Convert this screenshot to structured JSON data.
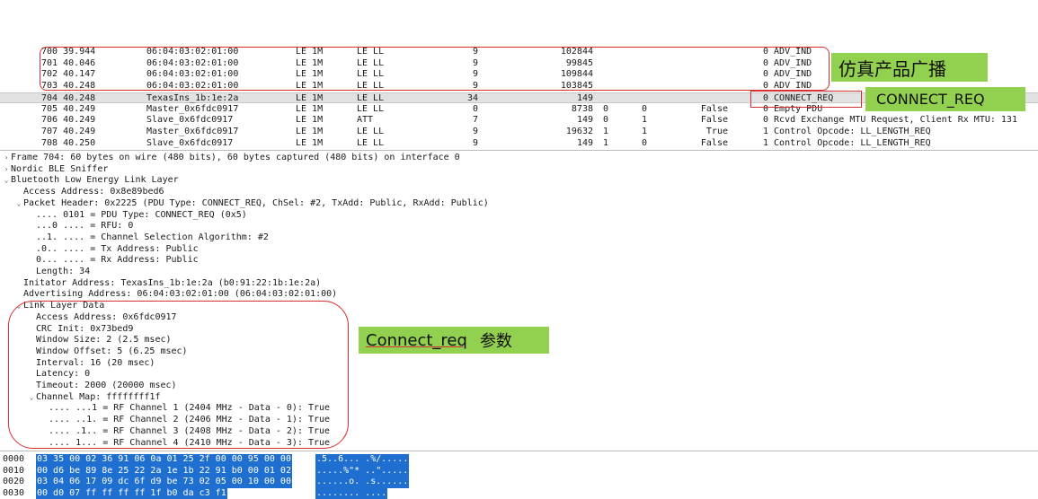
{
  "packets": [
    {
      "no_time": "700 39.944",
      "source": "06:04:03:02:01:00",
      "phy": "LE 1M",
      "protocol": "LE LL",
      "length": "9",
      "delta": "102844",
      "sn": "",
      "nesn": "",
      "more_data": "",
      "info": "0 ADV_IND"
    },
    {
      "no_time": "701 40.046",
      "source": "06:04:03:02:01:00",
      "phy": "LE 1M",
      "protocol": "LE LL",
      "length": "9",
      "delta": "99845",
      "sn": "",
      "nesn": "",
      "more_data": "",
      "info": "0 ADV_IND"
    },
    {
      "no_time": "702 40.147",
      "source": "06:04:03:02:01:00",
      "phy": "LE 1M",
      "protocol": "LE LL",
      "length": "9",
      "delta": "109844",
      "sn": "",
      "nesn": "",
      "more_data": "",
      "info": "0 ADV_IND"
    },
    {
      "no_time": "703 40.248",
      "source": "06:04:03:02:01:00",
      "phy": "LE 1M",
      "protocol": "LE LL",
      "length": "9",
      "delta": "103845",
      "sn": "",
      "nesn": "",
      "more_data": "",
      "info": "0 ADV_IND"
    },
    {
      "no_time": "704 40.248",
      "source": "TexasIns_1b:1e:2a",
      "phy": "LE 1M",
      "protocol": "LE LL",
      "length": "34",
      "delta": "149",
      "sn": "",
      "nesn": "",
      "more_data": "",
      "info": "0 CONNECT_REQ"
    },
    {
      "no_time": "705 40.249",
      "source": "Master_0x6fdc0917",
      "phy": "LE 1M",
      "protocol": "LE LL",
      "length": "0",
      "delta": "8738",
      "sn": "0",
      "nesn": "0",
      "more_data": "False",
      "info": "0 Empty PDU"
    },
    {
      "no_time": "706 40.249",
      "source": "Slave_0x6fdc0917",
      "phy": "LE 1M",
      "protocol": "ATT",
      "length": "7",
      "delta": "149",
      "sn": "0",
      "nesn": "1",
      "more_data": "False",
      "info": "0 Rcvd Exchange MTU Request, Client Rx MTU: 131"
    },
    {
      "no_time": "707 40.249",
      "source": "Master_0x6fdc0917",
      "phy": "LE 1M",
      "protocol": "LE LL",
      "length": "9",
      "delta": "19632",
      "sn": "1",
      "nesn": "1",
      "more_data": "True",
      "info": "1 Control Opcode: LL_LENGTH_REQ"
    },
    {
      "no_time": "708 40.250",
      "source": "Slave_0x6fdc0917",
      "phy": "LE 1M",
      "protocol": "LE LL",
      "length": "9",
      "delta": "149",
      "sn": "1",
      "nesn": "0",
      "more_data": "False",
      "info": "1 Control Opcode: LL_LENGTH_REQ"
    }
  ],
  "selected_packet_index": 4,
  "tree": [
    {
      "indent": 0,
      "arrow": "›",
      "text": "Frame 704: 60 bytes on wire (480 bits), 60 bytes captured (480 bits) on interface 0"
    },
    {
      "indent": 0,
      "arrow": "›",
      "text": "Nordic BLE Sniffer"
    },
    {
      "indent": 0,
      "arrow": "⌄",
      "text": "Bluetooth Low Energy Link Layer"
    },
    {
      "indent": 1,
      "arrow": "",
      "text": "Access Address: 0x8e89bed6"
    },
    {
      "indent": 1,
      "arrow": "⌄",
      "text": "Packet Header: 0x2225 (PDU Type: CONNECT_REQ, ChSel: #2, TxAdd: Public, RxAdd: Public)"
    },
    {
      "indent": 2,
      "arrow": "",
      "text": ".... 0101 = PDU Type: CONNECT_REQ (0x5)"
    },
    {
      "indent": 2,
      "arrow": "",
      "text": "...0 .... = RFU: 0"
    },
    {
      "indent": 2,
      "arrow": "",
      "text": "..1. .... = Channel Selection Algorithm: #2"
    },
    {
      "indent": 2,
      "arrow": "",
      "text": ".0.. .... = Tx Address: Public"
    },
    {
      "indent": 2,
      "arrow": "",
      "text": "0... .... = Rx Address: Public"
    },
    {
      "indent": 2,
      "arrow": "",
      "text": "Length: 34"
    },
    {
      "indent": 1,
      "arrow": "",
      "text": "Initator Address: TexasIns_1b:1e:2a (b0:91:22:1b:1e:2a)"
    },
    {
      "indent": 1,
      "arrow": "",
      "text": "Advertising Address: 06:04:03:02:01:00 (06:04:03:02:01:00)"
    },
    {
      "indent": 1,
      "arrow": "⌄",
      "text": "Link Layer Data"
    },
    {
      "indent": 2,
      "arrow": "",
      "text": "Access Address: 0x6fdc0917"
    },
    {
      "indent": 2,
      "arrow": "",
      "text": "CRC Init: 0x73bed9"
    },
    {
      "indent": 2,
      "arrow": "",
      "text": "Window Size: 2 (2.5 msec)"
    },
    {
      "indent": 2,
      "arrow": "",
      "text": "Window Offset: 5 (6.25 msec)"
    },
    {
      "indent": 2,
      "arrow": "",
      "text": "Interval: 16 (20 msec)"
    },
    {
      "indent": 2,
      "arrow": "",
      "text": "Latency: 0"
    },
    {
      "indent": 2,
      "arrow": "",
      "text": "Timeout: 2000 (20000 msec)"
    },
    {
      "indent": 2,
      "arrow": "⌄",
      "text": "Channel Map: ffffffff1f"
    },
    {
      "indent": 3,
      "arrow": "",
      "text": ".... ...1 = RF Channel 1 (2404 MHz - Data - 0): True"
    },
    {
      "indent": 3,
      "arrow": "",
      "text": ".... ..1. = RF Channel 2 (2406 MHz - Data - 1): True"
    },
    {
      "indent": 3,
      "arrow": "",
      "text": ".... .1.. = RF Channel 3 (2408 MHz - Data - 2): True"
    },
    {
      "indent": 3,
      "arrow": "",
      "text": ".... 1... = RF Channel 4 (2410 MHz - Data - 3): True"
    }
  ],
  "hex": [
    {
      "offset": "0000",
      "bytes": "03 35 00 02 36 91 06 0a  01 25 2f 00 00 95 00 00",
      "ascii": ".5..6... .%/....."
    },
    {
      "offset": "0010",
      "bytes": "00 d6 be 89 8e 25 22 2a  1e 1b 22 91 b0 00 01 02",
      "ascii": ".....%\"* ..\"....."
    },
    {
      "offset": "0020",
      "bytes": "03 04 06 17 09 dc 6f d9  be 73 02 05 00 10 00 00",
      "ascii": "......o. .s......"
    },
    {
      "offset": "0030",
      "bytes": "00 d0 07 ff ff ff ff 1f  b0 da c3 f1",
      "ascii": "........ ...."
    }
  ],
  "annotations": {
    "adv_label": "仿真产品广播",
    "connect_req_label": "CONNECT_REQ",
    "params_label_en": "Connect_req",
    "params_label_cn": "参数",
    "label_color": "#92d050",
    "box_color": "#d83030"
  }
}
